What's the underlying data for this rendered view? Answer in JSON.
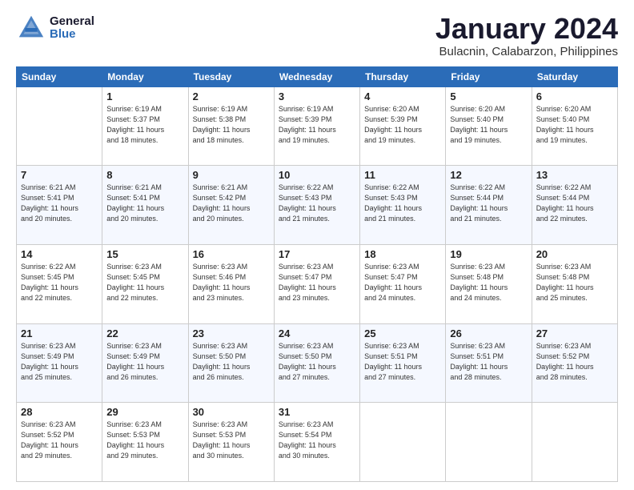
{
  "header": {
    "logo_general": "General",
    "logo_blue": "Blue",
    "month_title": "January 2024",
    "location": "Bulacnin, Calabarzon, Philippines"
  },
  "weekdays": [
    "Sunday",
    "Monday",
    "Tuesday",
    "Wednesday",
    "Thursday",
    "Friday",
    "Saturday"
  ],
  "weeks": [
    [
      {
        "day": "",
        "info": ""
      },
      {
        "day": "1",
        "info": "Sunrise: 6:19 AM\nSunset: 5:37 PM\nDaylight: 11 hours\nand 18 minutes."
      },
      {
        "day": "2",
        "info": "Sunrise: 6:19 AM\nSunset: 5:38 PM\nDaylight: 11 hours\nand 18 minutes."
      },
      {
        "day": "3",
        "info": "Sunrise: 6:19 AM\nSunset: 5:39 PM\nDaylight: 11 hours\nand 19 minutes."
      },
      {
        "day": "4",
        "info": "Sunrise: 6:20 AM\nSunset: 5:39 PM\nDaylight: 11 hours\nand 19 minutes."
      },
      {
        "day": "5",
        "info": "Sunrise: 6:20 AM\nSunset: 5:40 PM\nDaylight: 11 hours\nand 19 minutes."
      },
      {
        "day": "6",
        "info": "Sunrise: 6:20 AM\nSunset: 5:40 PM\nDaylight: 11 hours\nand 19 minutes."
      }
    ],
    [
      {
        "day": "7",
        "info": "Sunrise: 6:21 AM\nSunset: 5:41 PM\nDaylight: 11 hours\nand 20 minutes."
      },
      {
        "day": "8",
        "info": "Sunrise: 6:21 AM\nSunset: 5:41 PM\nDaylight: 11 hours\nand 20 minutes."
      },
      {
        "day": "9",
        "info": "Sunrise: 6:21 AM\nSunset: 5:42 PM\nDaylight: 11 hours\nand 20 minutes."
      },
      {
        "day": "10",
        "info": "Sunrise: 6:22 AM\nSunset: 5:43 PM\nDaylight: 11 hours\nand 21 minutes."
      },
      {
        "day": "11",
        "info": "Sunrise: 6:22 AM\nSunset: 5:43 PM\nDaylight: 11 hours\nand 21 minutes."
      },
      {
        "day": "12",
        "info": "Sunrise: 6:22 AM\nSunset: 5:44 PM\nDaylight: 11 hours\nand 21 minutes."
      },
      {
        "day": "13",
        "info": "Sunrise: 6:22 AM\nSunset: 5:44 PM\nDaylight: 11 hours\nand 22 minutes."
      }
    ],
    [
      {
        "day": "14",
        "info": "Sunrise: 6:22 AM\nSunset: 5:45 PM\nDaylight: 11 hours\nand 22 minutes."
      },
      {
        "day": "15",
        "info": "Sunrise: 6:23 AM\nSunset: 5:45 PM\nDaylight: 11 hours\nand 22 minutes."
      },
      {
        "day": "16",
        "info": "Sunrise: 6:23 AM\nSunset: 5:46 PM\nDaylight: 11 hours\nand 23 minutes."
      },
      {
        "day": "17",
        "info": "Sunrise: 6:23 AM\nSunset: 5:47 PM\nDaylight: 11 hours\nand 23 minutes."
      },
      {
        "day": "18",
        "info": "Sunrise: 6:23 AM\nSunset: 5:47 PM\nDaylight: 11 hours\nand 24 minutes."
      },
      {
        "day": "19",
        "info": "Sunrise: 6:23 AM\nSunset: 5:48 PM\nDaylight: 11 hours\nand 24 minutes."
      },
      {
        "day": "20",
        "info": "Sunrise: 6:23 AM\nSunset: 5:48 PM\nDaylight: 11 hours\nand 25 minutes."
      }
    ],
    [
      {
        "day": "21",
        "info": "Sunrise: 6:23 AM\nSunset: 5:49 PM\nDaylight: 11 hours\nand 25 minutes."
      },
      {
        "day": "22",
        "info": "Sunrise: 6:23 AM\nSunset: 5:49 PM\nDaylight: 11 hours\nand 26 minutes."
      },
      {
        "day": "23",
        "info": "Sunrise: 6:23 AM\nSunset: 5:50 PM\nDaylight: 11 hours\nand 26 minutes."
      },
      {
        "day": "24",
        "info": "Sunrise: 6:23 AM\nSunset: 5:50 PM\nDaylight: 11 hours\nand 27 minutes."
      },
      {
        "day": "25",
        "info": "Sunrise: 6:23 AM\nSunset: 5:51 PM\nDaylight: 11 hours\nand 27 minutes."
      },
      {
        "day": "26",
        "info": "Sunrise: 6:23 AM\nSunset: 5:51 PM\nDaylight: 11 hours\nand 28 minutes."
      },
      {
        "day": "27",
        "info": "Sunrise: 6:23 AM\nSunset: 5:52 PM\nDaylight: 11 hours\nand 28 minutes."
      }
    ],
    [
      {
        "day": "28",
        "info": "Sunrise: 6:23 AM\nSunset: 5:52 PM\nDaylight: 11 hours\nand 29 minutes."
      },
      {
        "day": "29",
        "info": "Sunrise: 6:23 AM\nSunset: 5:53 PM\nDaylight: 11 hours\nand 29 minutes."
      },
      {
        "day": "30",
        "info": "Sunrise: 6:23 AM\nSunset: 5:53 PM\nDaylight: 11 hours\nand 30 minutes."
      },
      {
        "day": "31",
        "info": "Sunrise: 6:23 AM\nSunset: 5:54 PM\nDaylight: 11 hours\nand 30 minutes."
      },
      {
        "day": "",
        "info": ""
      },
      {
        "day": "",
        "info": ""
      },
      {
        "day": "",
        "info": ""
      }
    ]
  ]
}
